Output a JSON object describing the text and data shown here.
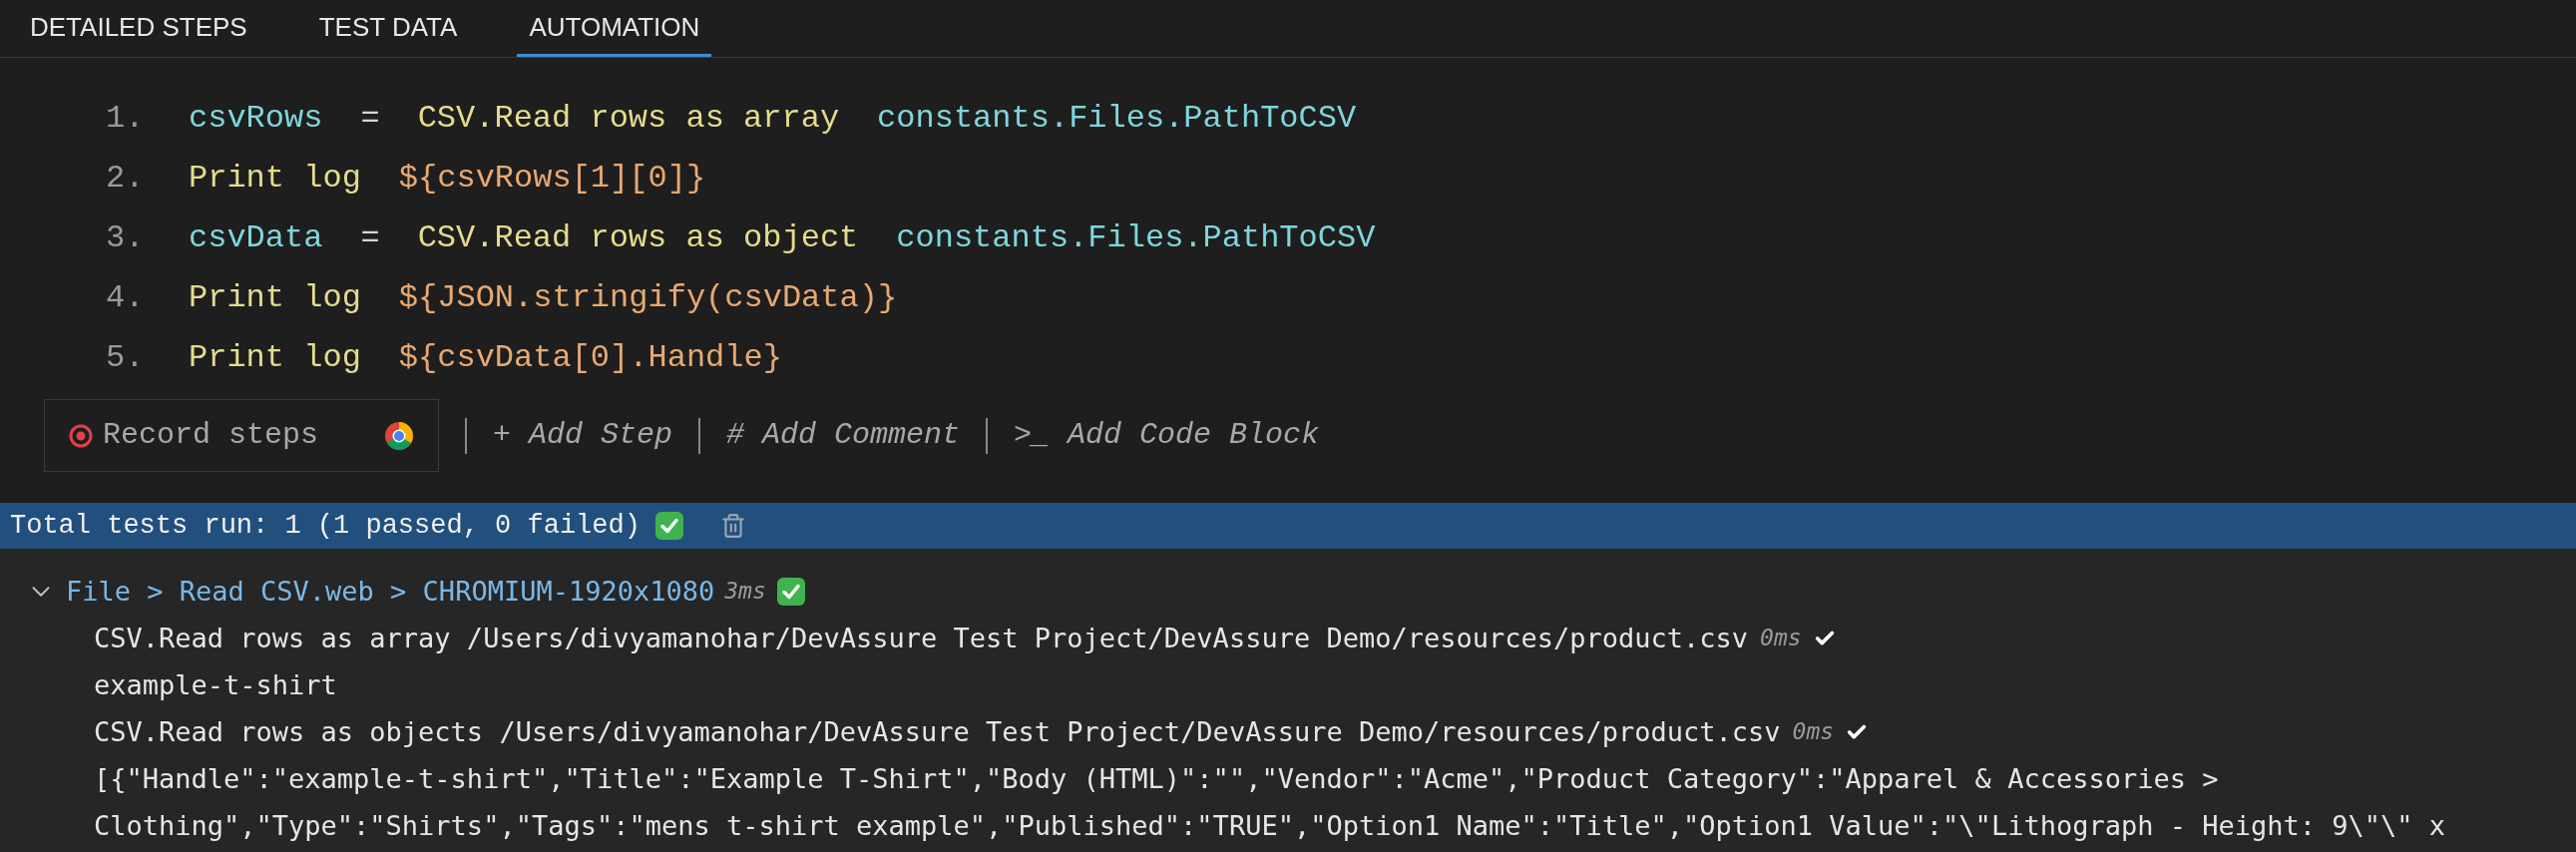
{
  "tabs": [
    {
      "label": "DETAILED STEPS",
      "selected": false
    },
    {
      "label": "TEST DATA",
      "selected": false
    },
    {
      "label": "AUTOMATION",
      "selected": true
    }
  ],
  "steps": [
    {
      "number": "1.",
      "tokens": [
        {
          "kind": "variable",
          "text": "csvRows"
        },
        {
          "kind": "operator",
          "text": "="
        },
        {
          "kind": "action",
          "text": "CSV.Read rows as array"
        },
        {
          "kind": "argument",
          "text": "constants.Files.PathToCSV"
        }
      ]
    },
    {
      "number": "2.",
      "tokens": [
        {
          "kind": "action",
          "text": "Print log"
        },
        {
          "kind": "expression",
          "text": "${csvRows[1][0]}"
        }
      ]
    },
    {
      "number": "3.",
      "tokens": [
        {
          "kind": "variable",
          "text": "csvData"
        },
        {
          "kind": "operator",
          "text": "="
        },
        {
          "kind": "action",
          "text": "CSV.Read rows as object"
        },
        {
          "kind": "argument",
          "text": "constants.Files.PathToCSV"
        }
      ]
    },
    {
      "number": "4.",
      "tokens": [
        {
          "kind": "action",
          "text": "Print log"
        },
        {
          "kind": "expression",
          "text": "${JSON.stringify(csvData)}"
        }
      ]
    },
    {
      "number": "5.",
      "tokens": [
        {
          "kind": "action",
          "text": "Print log"
        },
        {
          "kind": "expression",
          "text": "${csvData[0].Handle}"
        }
      ]
    }
  ],
  "toolbar": {
    "record_button": {
      "label": "Record steps"
    },
    "actions": [
      {
        "label": "+ Add Step"
      },
      {
        "label": "# Add Comment"
      },
      {
        "label": ">_ Add Code Block"
      }
    ]
  },
  "status_bar": {
    "text": "Total tests run: 1 (1 passed, 0 failed)",
    "passed": true
  },
  "results": {
    "header": {
      "path": "File > Read CSV.web > CHROMIUM-1920x1080",
      "duration": "3ms",
      "passed": true,
      "expanded": true
    },
    "logs": [
      {
        "kind": "step",
        "text": "CSV.Read rows as array /Users/divyamanohar/DevAssure Test Project/DevAssure Demo/resources/product.csv",
        "duration": "0ms",
        "passed": true
      },
      {
        "kind": "output",
        "text": "example-t-shirt"
      },
      {
        "kind": "step",
        "text": "CSV.Read rows as objects /Users/divyamanohar/DevAssure Test Project/DevAssure Demo/resources/product.csv",
        "duration": "0ms",
        "passed": true
      },
      {
        "kind": "output",
        "text": "[{\"Handle\":\"example-t-shirt\",\"Title\":\"Example T-Shirt\",\"Body (HTML)\":\"\",\"Vendor\":\"Acme\",\"Product Category\":\"Apparel & Accessories > Clothing\",\"Type\":\"Shirts\",\"Tags\":\"mens t-shirt example\",\"Published\":\"TRUE\",\"Option1 Name\":\"Title\",\"Option1 Value\":\"\\\"Lithograph - Height: 9\\\"\\\" x"
      }
    ]
  }
}
